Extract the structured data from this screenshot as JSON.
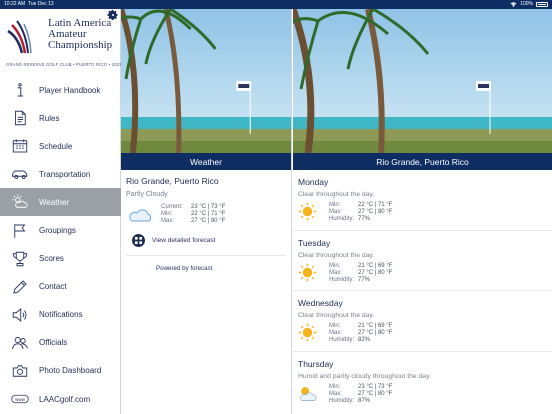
{
  "status": {
    "time": "10:22 AM",
    "date": "Tue Dec 13",
    "battery": "100%"
  },
  "logo": {
    "title": "Latin America Amateur Championship",
    "subtitle": "GRAND RESERVE GOLF CLUB • PUERTO RICO • 2023",
    "icon": "gear-icon"
  },
  "nav": [
    {
      "label": "Player Handbook",
      "icon": "info-icon"
    },
    {
      "label": "Rules",
      "icon": "document-icon"
    },
    {
      "label": "Schedule",
      "icon": "calendar-icon"
    },
    {
      "label": "Transportation",
      "icon": "car-icon"
    },
    {
      "label": "Weather",
      "icon": "weather-icon",
      "active": true
    },
    {
      "label": "Groupings",
      "icon": "flag-icon"
    },
    {
      "label": "Scores",
      "icon": "trophy-icon"
    },
    {
      "label": "Contact",
      "icon": "pencil-icon"
    },
    {
      "label": "Notifications",
      "icon": "speaker-icon"
    },
    {
      "label": "Officials",
      "icon": "people-icon"
    },
    {
      "label": "Photo Dashboard",
      "icon": "camera-icon"
    },
    {
      "label": "LAACgolf.com",
      "icon": "www-icon"
    }
  ],
  "left": {
    "bar_title": "Weather",
    "location": "Rio Grande, Puerto Rico",
    "condition": "Partly Cloudy",
    "labels": {
      "current": "Current:",
      "min": "Min:",
      "max": "Max:"
    },
    "values": {
      "current": "23 °C | 73 °F",
      "min": "22 °C | 71 °F",
      "max": "27 °C | 80 °F"
    },
    "forecast_link": "View detailed forecast",
    "powered": "Powered by forecast"
  },
  "right": {
    "bar_title": "Rio Grande, Puerto Rico",
    "labels": {
      "min": "Min:",
      "max": "Max:",
      "humidity": "Humidity:"
    },
    "days": [
      {
        "name": "Monday",
        "desc": "Clear throughout the day.",
        "min": "22 °C | 71 °F",
        "max": "27 °C | 80 °F",
        "humidity": "77%",
        "icon": "sun-icon"
      },
      {
        "name": "Tuesday",
        "desc": "Clear throughout the day.",
        "min": "21 °C | 69 °F",
        "max": "27 °C | 80 °F",
        "humidity": "77%",
        "icon": "sun-icon"
      },
      {
        "name": "Wednesday",
        "desc": "Clear throughout the day.",
        "min": "21 °C | 69 °F",
        "max": "27 °C | 80 °F",
        "humidity": "82%",
        "icon": "sun-icon"
      },
      {
        "name": "Thursday",
        "desc": "Humid and partly cloudy throughout the day.",
        "min": "23 °C | 73 °F",
        "max": "27 °C | 80 °F",
        "humidity": "87%",
        "icon": "partly-cloudy-icon"
      }
    ]
  }
}
